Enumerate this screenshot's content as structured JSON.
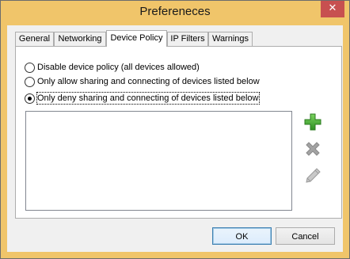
{
  "window": {
    "title": "Prefereneces",
    "close_glyph": "✕"
  },
  "tabs": [
    {
      "label": "General",
      "active": false
    },
    {
      "label": "Networking",
      "active": false
    },
    {
      "label": "Device Policy",
      "active": true
    },
    {
      "label": "IP Filters",
      "active": false
    },
    {
      "label": "Warnings",
      "active": false
    }
  ],
  "policy_options": [
    {
      "label": "Disable device policy (all devices allowed)",
      "selected": false
    },
    {
      "label": "Only allow sharing and connecting of devices listed below",
      "selected": false
    },
    {
      "label": "Only deny sharing and connecting of devices listed below",
      "selected": true
    }
  ],
  "device_list": {
    "items": []
  },
  "side_actions": {
    "add_icon": "plus-icon",
    "remove_icon": "x-icon",
    "edit_icon": "pencil-icon",
    "add_color": "#3aa52c",
    "remove_color": "#9a9a9a",
    "edit_color": "#a8a8a8"
  },
  "footer": {
    "ok_label": "OK",
    "cancel_label": "Cancel"
  }
}
